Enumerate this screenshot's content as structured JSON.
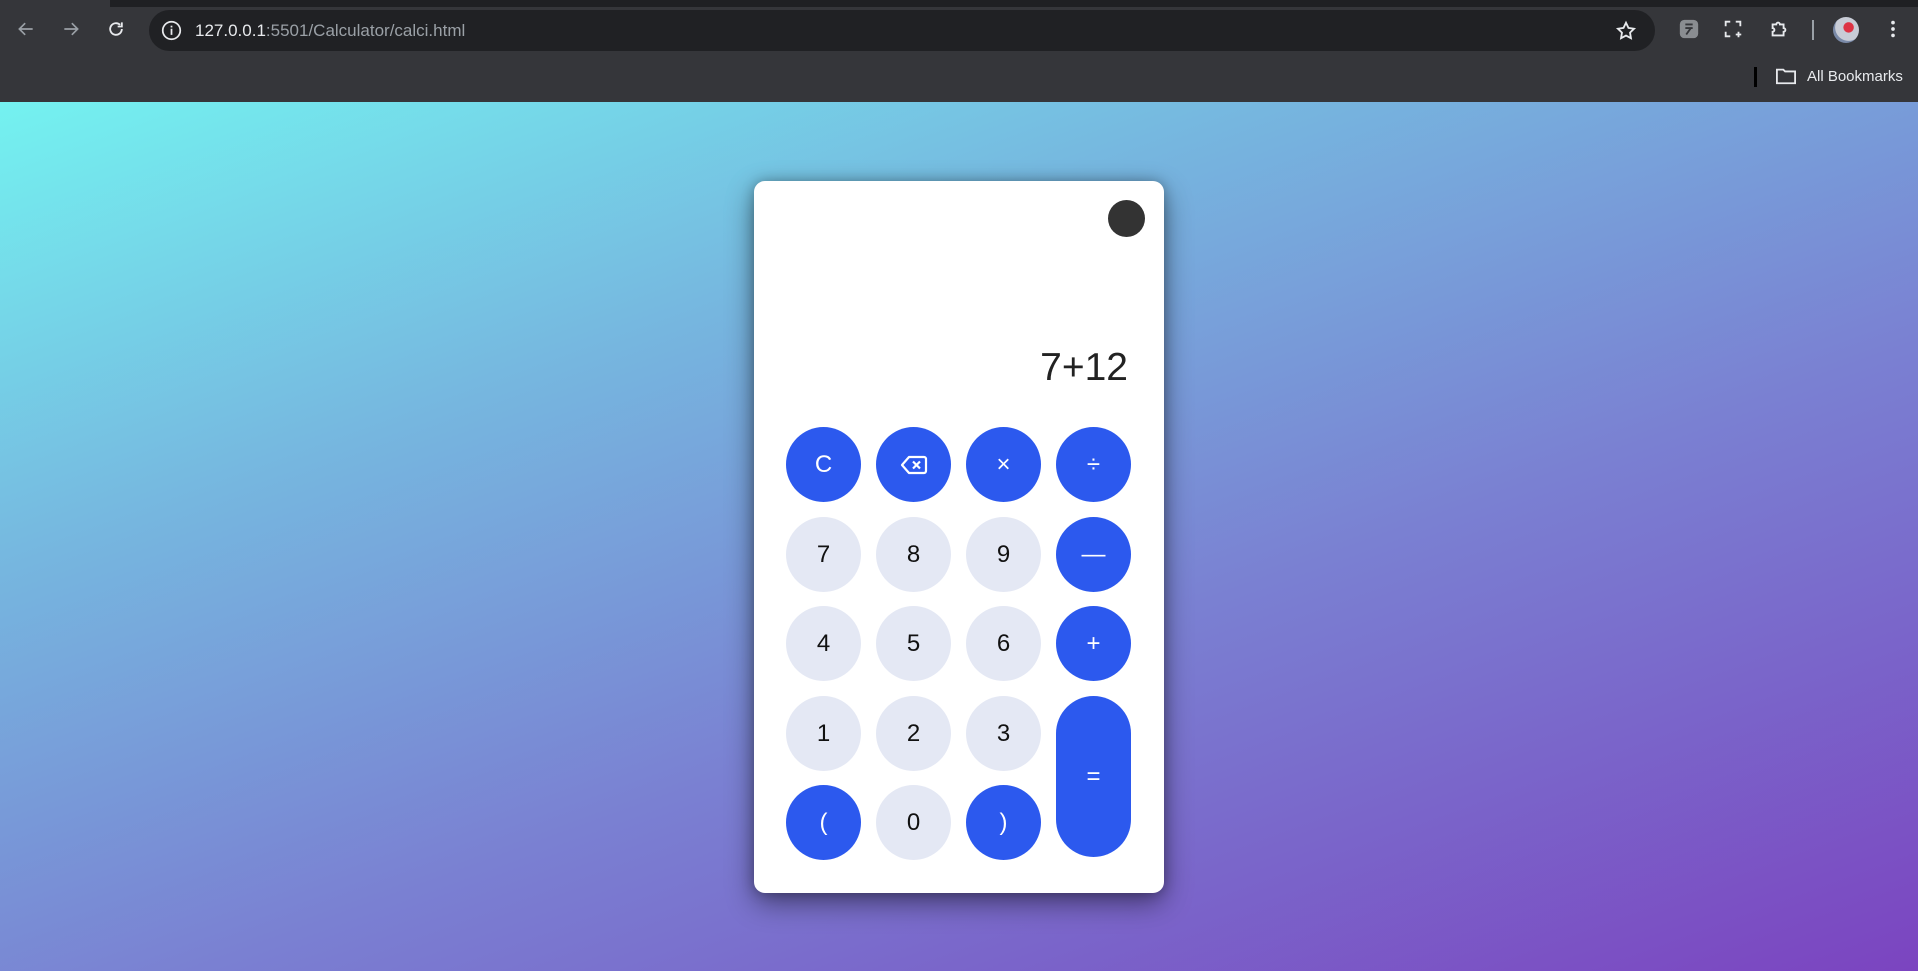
{
  "browser": {
    "url_host": "127.0.0.1",
    "url_rest": ":5501/Calculator/calci.html",
    "bookmarks_label": "All Bookmarks"
  },
  "calculator": {
    "display": "7+12",
    "keys": {
      "clear": "C",
      "backspace": "backspace-icon",
      "multiply": "×",
      "divide": "÷",
      "seven": "7",
      "eight": "8",
      "nine": "9",
      "minus": "—",
      "four": "4",
      "five": "5",
      "six": "6",
      "plus": "+",
      "one": "1",
      "two": "2",
      "three": "3",
      "equals": "=",
      "open_paren": "(",
      "zero": "0",
      "close_paren": ")"
    }
  },
  "colors": {
    "operator_key": "#2c59ee",
    "number_key": "#e4e8f4",
    "theme_toggle": "#333333",
    "gradient_start": "#74f2f0",
    "gradient_end": "#7b44c0"
  }
}
